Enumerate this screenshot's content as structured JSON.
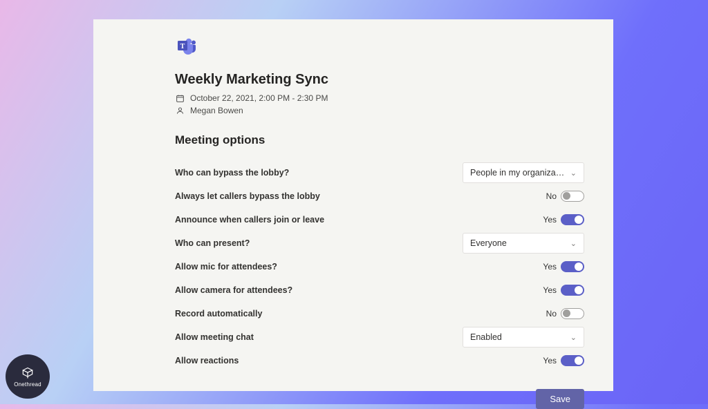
{
  "meeting": {
    "title": "Weekly Marketing Sync",
    "datetime": "October 22, 2021, 2:00 PM - 2:30 PM",
    "organizer": "Megan Bowen"
  },
  "section_title": "Meeting options",
  "options": {
    "bypass_lobby": {
      "label": "Who can bypass the lobby?",
      "value": "People in my organization and gu..."
    },
    "callers_bypass": {
      "label": "Always let callers bypass the lobby",
      "value_label": "No",
      "on": false
    },
    "announce": {
      "label": "Announce when callers join or leave",
      "value_label": "Yes",
      "on": true
    },
    "present": {
      "label": "Who can present?",
      "value": "Everyone"
    },
    "allow_mic": {
      "label": "Allow mic for attendees?",
      "value_label": "Yes",
      "on": true
    },
    "allow_cam": {
      "label": "Allow camera for attendees?",
      "value_label": "Yes",
      "on": true
    },
    "record": {
      "label": "Record automatically",
      "value_label": "No",
      "on": false
    },
    "chat": {
      "label": "Allow meeting chat",
      "value": "Enabled"
    },
    "reactions": {
      "label": "Allow reactions",
      "value_label": "Yes",
      "on": true
    }
  },
  "save_label": "Save",
  "badge": "Onethread"
}
